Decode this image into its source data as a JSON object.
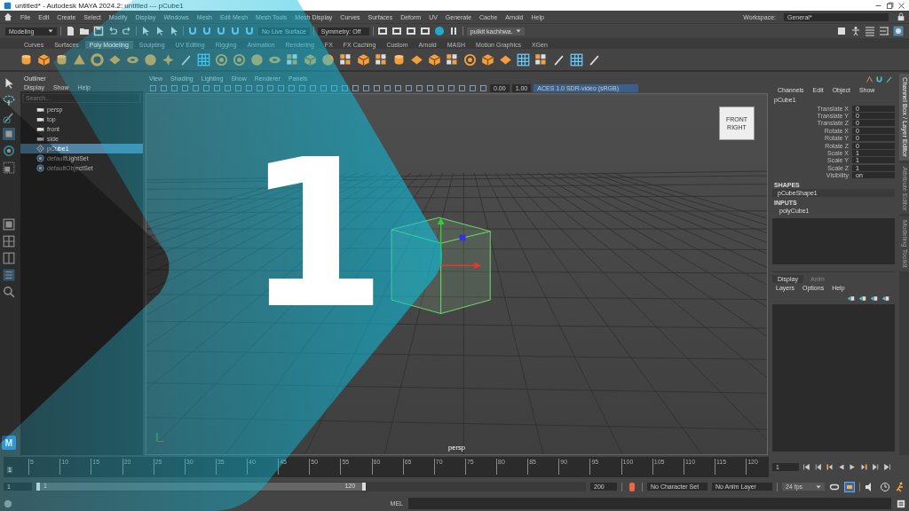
{
  "window": {
    "title": "untitled* - Autodesk MAYA 2024.2: untitled   ---   pCube1"
  },
  "menu_bar": {
    "items": [
      "File",
      "Edit",
      "Create",
      "Select",
      "Modify",
      "Display",
      "Windows",
      "Mesh",
      "Edit Mesh",
      "Mesh Tools",
      "Mesh Display",
      "Curves",
      "Surfaces",
      "Deform",
      "UV",
      "Generate",
      "Cache",
      "Arnold",
      "Help"
    ],
    "workspace_label": "Workspace:",
    "workspace_value": "General*"
  },
  "status_line": {
    "mode": "Modeling",
    "live_surface": "No Live Surface",
    "symmetry": "Symmetry: Off",
    "user": "pulkit kachhwa."
  },
  "shelf": {
    "tabs": [
      {
        "label": "Curves",
        "selected": false
      },
      {
        "label": "Surfaces",
        "selected": false
      },
      {
        "label": "Poly Modeling",
        "selected": true
      },
      {
        "label": "Sculpting",
        "selected": false
      },
      {
        "label": "UV Editing",
        "selected": false
      },
      {
        "label": "Rigging",
        "selected": false
      },
      {
        "label": "Animation",
        "selected": false
      },
      {
        "label": "Rendering",
        "selected": false
      },
      {
        "label": "FX",
        "selected": false
      },
      {
        "label": "FX Caching",
        "selected": false
      },
      {
        "label": "Custom",
        "selected": false
      },
      {
        "label": "Arnold",
        "selected": false
      },
      {
        "label": "MASH",
        "selected": false
      },
      {
        "label": "Motion Graphics",
        "selected": false
      },
      {
        "label": "XGen",
        "selected": false
      }
    ]
  },
  "toolbox": {
    "logo": "M"
  },
  "outliner": {
    "title": "Outliner",
    "menus": [
      "Display",
      "Show",
      "Help"
    ],
    "search_placeholder": "Search...",
    "items": [
      {
        "label": "persp",
        "kind": "camera",
        "selected": false
      },
      {
        "label": "top",
        "kind": "camera",
        "selected": false
      },
      {
        "label": "front",
        "kind": "camera",
        "selected": false
      },
      {
        "label": "side",
        "kind": "camera",
        "selected": false
      },
      {
        "label": "pCube1",
        "kind": "mesh",
        "selected": true
      },
      {
        "label": "defaultLightSet",
        "kind": "set",
        "selected": false
      },
      {
        "label": "defaultObjectSet",
        "kind": "set",
        "selected": false
      }
    ]
  },
  "viewport": {
    "menus": [
      "View",
      "Shading",
      "Lighting",
      "Show",
      "Renderer",
      "Panels"
    ],
    "exposure": "0.00",
    "gamma": "1.00",
    "color_space": "ACES 1.0 SDR-video (sRGB)",
    "viewcube": [
      "FRONT",
      "RIGHT"
    ],
    "camera_label": "persp"
  },
  "channel_box": {
    "menus": [
      "Channels",
      "Edit",
      "Object",
      "Show"
    ],
    "object": "pCube1",
    "channels": [
      {
        "name": "Translate X",
        "value": "0"
      },
      {
        "name": "Translate Y",
        "value": "0"
      },
      {
        "name": "Translate Z",
        "value": "0"
      },
      {
        "name": "Rotate X",
        "value": "0"
      },
      {
        "name": "Rotate Y",
        "value": "0"
      },
      {
        "name": "Rotate Z",
        "value": "0"
      },
      {
        "name": "Scale X",
        "value": "1"
      },
      {
        "name": "Scale Y",
        "value": "1"
      },
      {
        "name": "Scale Z",
        "value": "1"
      },
      {
        "name": "Visibility",
        "value": "on"
      }
    ],
    "shapes_heading": "SHAPES",
    "shape": "pCubeShape1",
    "inputs_heading": "INPUTS",
    "input": "polyCube1"
  },
  "layer_editor": {
    "tabs": [
      {
        "label": "Display",
        "selected": true
      },
      {
        "label": "Anim",
        "selected": false
      }
    ],
    "menus": [
      "Layers",
      "Options",
      "Help"
    ]
  },
  "side_tabs": [
    {
      "label": "Channel Box / Layer Editor",
      "selected": true
    },
    {
      "label": "Attribute Editor",
      "selected": false
    },
    {
      "label": "Modeling Toolkit",
      "selected": false
    }
  ],
  "time_slider": {
    "level": 0,
    "current_frame": "1",
    "ticks": [
      "5",
      "10",
      "15",
      "20",
      "25",
      "30",
      "35",
      "40",
      "45",
      "50",
      "55",
      "60",
      "65",
      "70",
      "75",
      "80",
      "85",
      "90",
      "95",
      "100",
      "105",
      "110",
      "115",
      "120"
    ],
    "frame_field": "1"
  },
  "range_slider": {
    "level": 0.6,
    "start": "1",
    "range_start": "1",
    "range_end": "120",
    "end": "200",
    "character_set": "No Character Set",
    "anim_layer": "No Anim Layer",
    "fps": "24 fps"
  },
  "command_line": {
    "language": "MEL"
  },
  "overlay": {
    "number": "1"
  }
}
